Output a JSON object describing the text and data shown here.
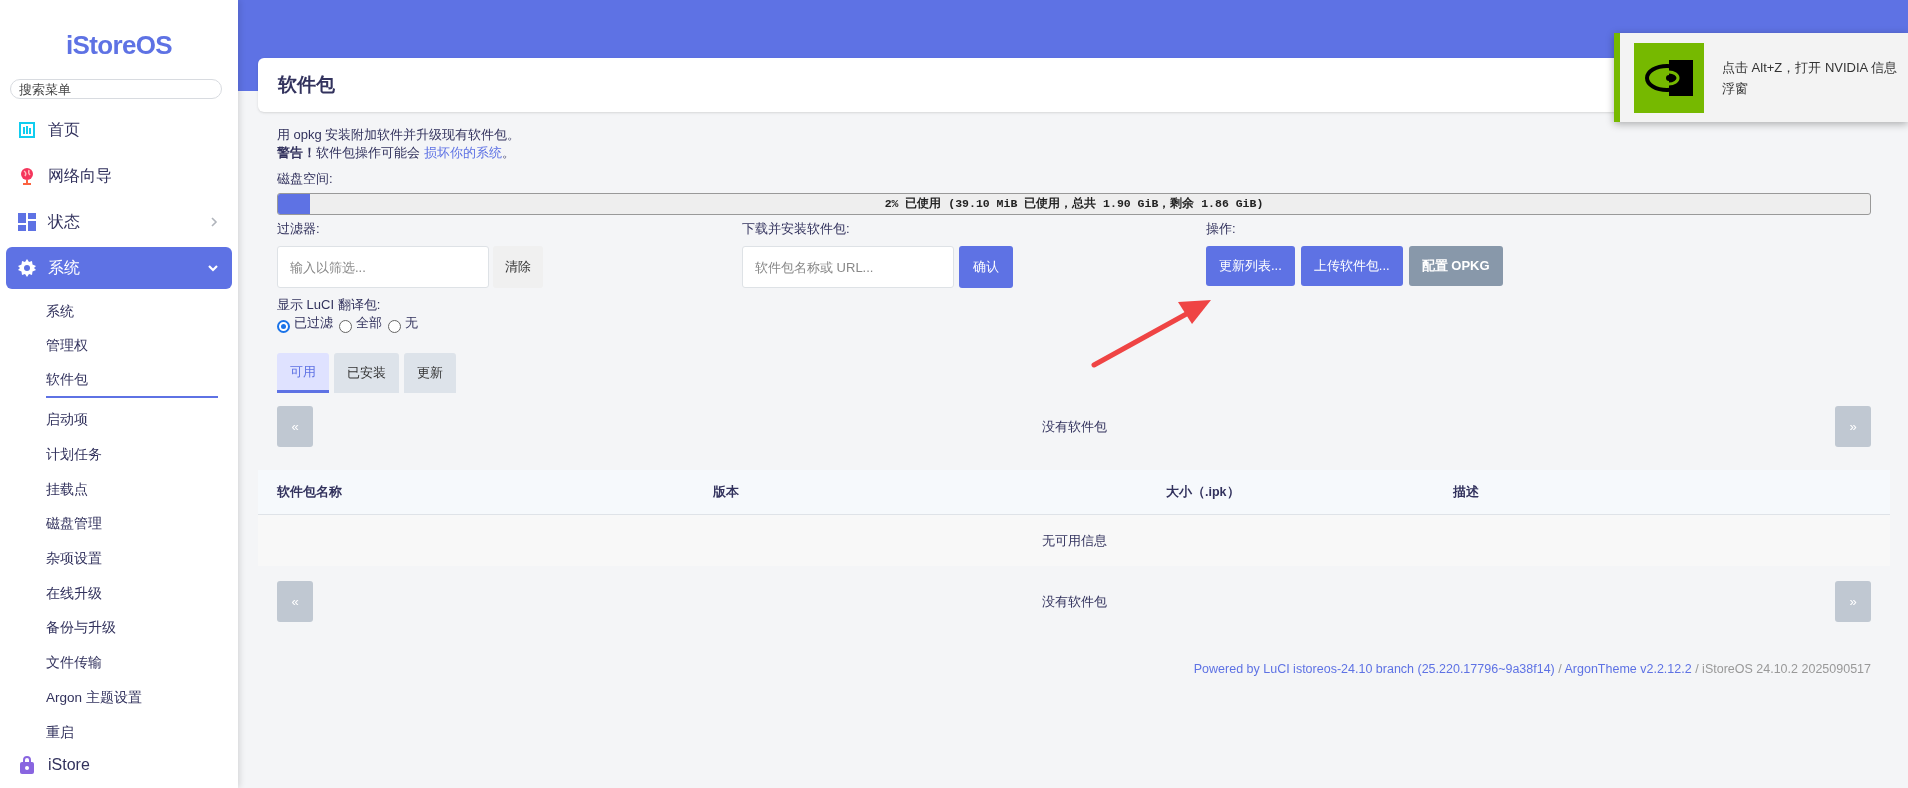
{
  "sidebar": {
    "logo": "iStoreOS",
    "search": {
      "placeholder": "搜索菜单"
    },
    "items": [
      {
        "label": "首页",
        "kind": "link",
        "selected": false
      },
      {
        "label": "网络向导",
        "kind": "link",
        "selected": false
      },
      {
        "label": "状态",
        "kind": "group",
        "selected": false,
        "expanded": false
      },
      {
        "label": "系统",
        "kind": "group",
        "selected": true,
        "expanded": true,
        "children": [
          {
            "label": "系统",
            "selected": false
          },
          {
            "label": "管理权",
            "selected": false
          },
          {
            "label": "软件包",
            "selected": true
          },
          {
            "label": "启动项",
            "selected": false
          },
          {
            "label": "计划任务",
            "selected": false
          },
          {
            "label": "挂载点",
            "selected": false
          },
          {
            "label": "磁盘管理",
            "selected": false
          },
          {
            "label": "杂项设置",
            "selected": false
          },
          {
            "label": "在线升级",
            "selected": false
          },
          {
            "label": "备份与升级",
            "selected": false
          },
          {
            "label": "文件传输",
            "selected": false
          },
          {
            "label": "Argon 主题设置",
            "selected": false
          },
          {
            "label": "重启",
            "selected": false
          }
        ]
      },
      {
        "label": "iStore",
        "kind": "link",
        "selected": false
      }
    ]
  },
  "page": {
    "title": "软件包",
    "intro": "用 opkg 安装附加软件并升级现有软件包。",
    "warning": {
      "text": "**警告！**软件包操作可能会 ",
      "link": "损坏你的系统",
      "after": "。"
    },
    "disk": {
      "label": "磁盘空间:",
      "level": 0.02,
      "reading": "2% 已使用 (39.10 MiB 已使用，总共 1.90 GiB，剩余 1.86 GiB)"
    },
    "filter": {
      "label": "过滤器:",
      "placeholder": "输入以筛选...",
      "button": "清除"
    },
    "install": {
      "label": "下载并安装软件包:",
      "placeholder": "软件包名称或 URL...",
      "button": "确认"
    },
    "actions": {
      "label": "操作:",
      "buttons": [
        {
          "label": "更新列表...",
          "kind": "primary"
        },
        {
          "label": "上传软件包...",
          "kind": "primary"
        },
        {
          "label": "配置 OPKG",
          "kind": "secondary"
        }
      ]
    },
    "translations": {
      "label": "显示 LuCI 翻译包:",
      "options": [
        {
          "label": "已过滤",
          "selected": true
        },
        {
          "label": "全部",
          "selected": false
        },
        {
          "label": "无",
          "selected": false
        }
      ]
    },
    "tabs": [
      {
        "label": "可用",
        "selected": true
      },
      {
        "label": "已安装",
        "selected": false
      },
      {
        "label": "更新",
        "selected": false
      }
    ],
    "pager_top": {
      "prev": "«",
      "text": "没有软件包",
      "next": "»"
    },
    "table": {
      "columns": [
        "软件包名称",
        "版本",
        "大小（.ipk）",
        "描述"
      ],
      "empty": "无可用信息"
    },
    "pager_bottom": {
      "prev": "«",
      "text": "没有软件包",
      "next": "»"
    },
    "footer": {
      "luci": "Powered by LuCI istoreos-24.10 branch (25.220.17796~9a38f14)",
      "sep": " / ",
      "theme": "ArgonTheme v2.2.12.2",
      "version": " / iStoreOS 24.10.2 2025090517"
    }
  },
  "notification": {
    "text": "点击 Alt+Z，打开 NVIDIA 信息浮窗"
  }
}
